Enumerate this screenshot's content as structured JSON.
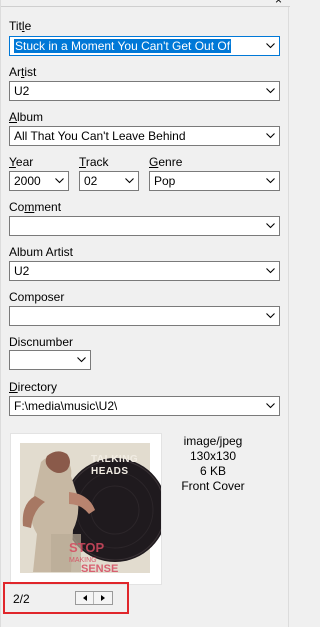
{
  "window": {
    "close_glyph": "×"
  },
  "fields": {
    "title": {
      "label": "Title",
      "value": "Stuck in a Moment You Can't Get Out Of"
    },
    "artist": {
      "label": "Artist",
      "value": "U2"
    },
    "album": {
      "label": "Album",
      "value": "All That You Can't Leave Behind"
    },
    "year": {
      "label": "Year",
      "value": "2000"
    },
    "track": {
      "label": "Track",
      "value": "02"
    },
    "genre": {
      "label": "Genre",
      "value": "Pop"
    },
    "comment": {
      "label": "Comment",
      "value": ""
    },
    "album_artist": {
      "label": "Album Artist",
      "value": "U2"
    },
    "composer": {
      "label": "Composer",
      "value": ""
    },
    "discnumber": {
      "label": "Discnumber",
      "value": ""
    },
    "directory": {
      "label": "Directory",
      "value": "F:\\media\\music\\U2\\"
    }
  },
  "cover": {
    "art_text_1": "TALKING",
    "art_text_2": "HEADS",
    "art_text_3": "STOP",
    "art_text_4": "MAKING",
    "art_text_5": "SENSE",
    "mime": "image/jpeg",
    "dimensions": "130x130",
    "size": "6 KB",
    "type": "Front Cover"
  },
  "pager": {
    "text": "2/2"
  },
  "colors": {
    "accent": "#0078d7",
    "highlight_box": "#e0262b",
    "background": "#f0f0f0"
  }
}
